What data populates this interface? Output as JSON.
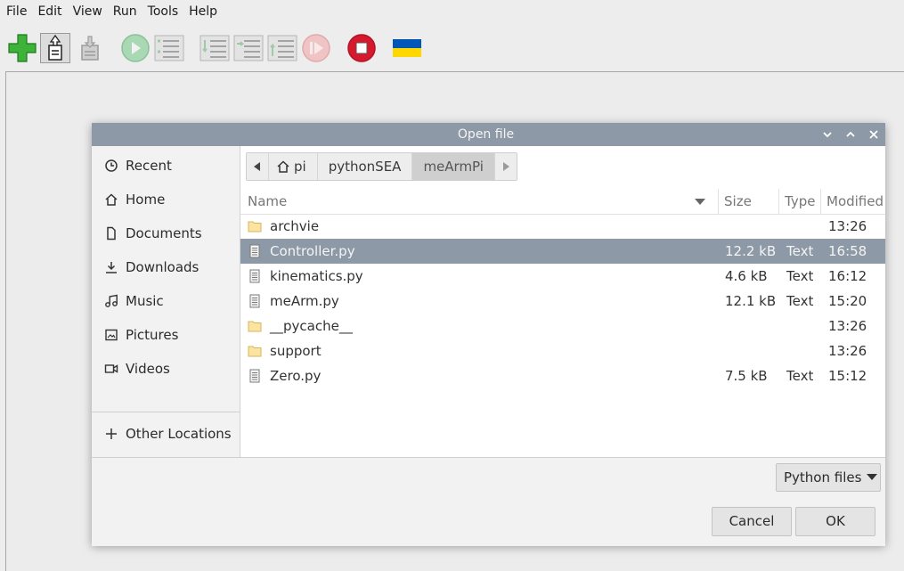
{
  "menu": [
    "File",
    "Edit",
    "View",
    "Run",
    "Tools",
    "Help"
  ],
  "dialog": {
    "title": "Open file",
    "places": [
      {
        "label": "Recent",
        "icon": "clock-icon"
      },
      {
        "label": "Home",
        "icon": "home-icon"
      },
      {
        "label": "Documents",
        "icon": "document-icon"
      },
      {
        "label": "Downloads",
        "icon": "download-icon"
      },
      {
        "label": "Music",
        "icon": "music-icon"
      },
      {
        "label": "Pictures",
        "icon": "picture-icon"
      },
      {
        "label": "Videos",
        "icon": "video-icon"
      }
    ],
    "other_locations": "Other Locations",
    "path": [
      "pi",
      "pythonSEA",
      "meArmPi"
    ],
    "columns": {
      "name": "Name",
      "size": "Size",
      "type": "Type",
      "modified": "Modified"
    },
    "files": [
      {
        "name": "archvie",
        "size": "",
        "type": "",
        "modified": "13:26",
        "kind": "folder"
      },
      {
        "name": "Controller.py",
        "size": "12.2 kB",
        "type": "Text",
        "modified": "16:58",
        "kind": "text",
        "selected": true
      },
      {
        "name": "kinematics.py",
        "size": "4.6 kB",
        "type": "Text",
        "modified": "16:12",
        "kind": "text"
      },
      {
        "name": "meArm.py",
        "size": "12.1 kB",
        "type": "Text",
        "modified": "15:20",
        "kind": "text"
      },
      {
        "name": "__pycache__",
        "size": "",
        "type": "",
        "modified": "13:26",
        "kind": "folder"
      },
      {
        "name": "support",
        "size": "",
        "type": "",
        "modified": "13:26",
        "kind": "folder"
      },
      {
        "name": "Zero.py",
        "size": "7.5 kB",
        "type": "Text",
        "modified": "15:12",
        "kind": "text"
      }
    ],
    "filter": "Python files",
    "cancel": "Cancel",
    "ok": "OK"
  },
  "colors": {
    "accent": "#8d99a6",
    "stop": "#d7192e",
    "flag_blue": "#0057b8",
    "flag_yellow": "#ffd700"
  }
}
